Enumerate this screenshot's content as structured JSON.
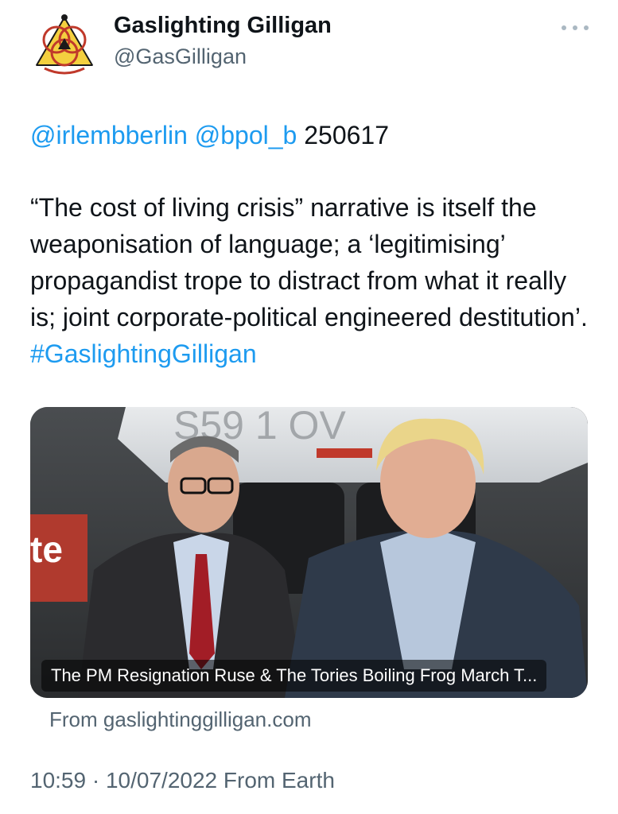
{
  "author": {
    "name": "Gaslighting Gilligan",
    "handle": "@GasGilligan",
    "avatar_icon": "venn-triangle-logo"
  },
  "menu": {
    "icon": "more-options-icon"
  },
  "tweet": {
    "mentions": [
      "@irlembberlin",
      "@bpol_b"
    ],
    "ref_code": "250617",
    "body_text": "“The cost of living crisis” narrative is itself the weaponisation of language; a ‘legitimising’ propagandist trope to distract from what it really is; joint corporate-political engineered destitution’.",
    "hashtag": "#GaslightingGilligan"
  },
  "card": {
    "title": "The PM Resignation Ruse & The Tories Boiling Frog March T...",
    "source": "From gaslightinggilligan.com"
  },
  "meta": {
    "time": "10:59",
    "separator": "·",
    "date": "10/07/2022",
    "source": "From Earth"
  },
  "colors": {
    "link": "#1d9bf0",
    "text": "#0f1419",
    "muted": "#536471"
  }
}
